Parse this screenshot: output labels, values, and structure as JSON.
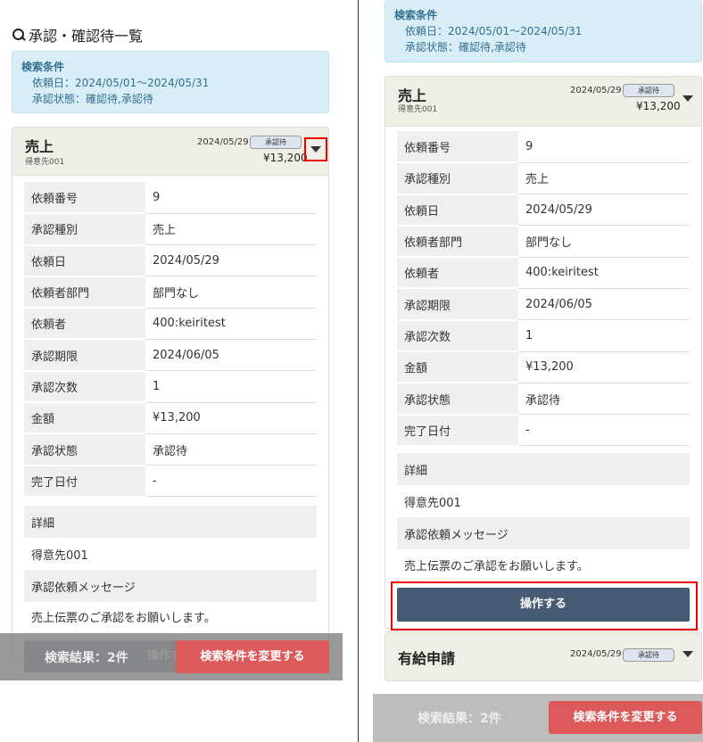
{
  "page_title": "承認・確認待一覧",
  "search_criteria": {
    "title": "検索条件",
    "date_range": "依頼日：2024/05/01〜2024/05/31",
    "status": "承認状態：確認待,承認待"
  },
  "card1": {
    "title": "売上",
    "subtitle": "得意先001",
    "date": "2024/05/29",
    "badge": "承認待",
    "amount": "¥13,200"
  },
  "details": [
    {
      "label": "依頼番号",
      "value": "9"
    },
    {
      "label": "承認種別",
      "value": "売上"
    },
    {
      "label": "依頼日",
      "value": "2024/05/29"
    },
    {
      "label": "依頼者部門",
      "value": "部門なし"
    },
    {
      "label": "依頼者",
      "value": "400:keiritest"
    },
    {
      "label": "承認期限",
      "value": "2024/06/05"
    },
    {
      "label": "承認次数",
      "value": "1"
    },
    {
      "label": "金額",
      "value": "¥13,200"
    },
    {
      "label": "承認状態",
      "value": "承認待"
    },
    {
      "label": "完了日付",
      "value": "-"
    }
  ],
  "detail_section": {
    "heading": "詳細",
    "customer": "得意先001",
    "message_heading": "承認依頼メッセージ",
    "message": "売上伝票のご承認をお願いします。"
  },
  "operate_button": "操作する",
  "card2": {
    "title": "有給申請",
    "date": "2024/05/29",
    "badge": "承認待"
  },
  "footer": {
    "result_count": "検索結果：2件",
    "change_button": "検索条件を変更する"
  },
  "colors": {
    "accent_red": "#dd5a5a",
    "operate_blue": "#475b74",
    "criteria_bg": "#d9edf7",
    "card_header_bg": "#f0efe6"
  }
}
